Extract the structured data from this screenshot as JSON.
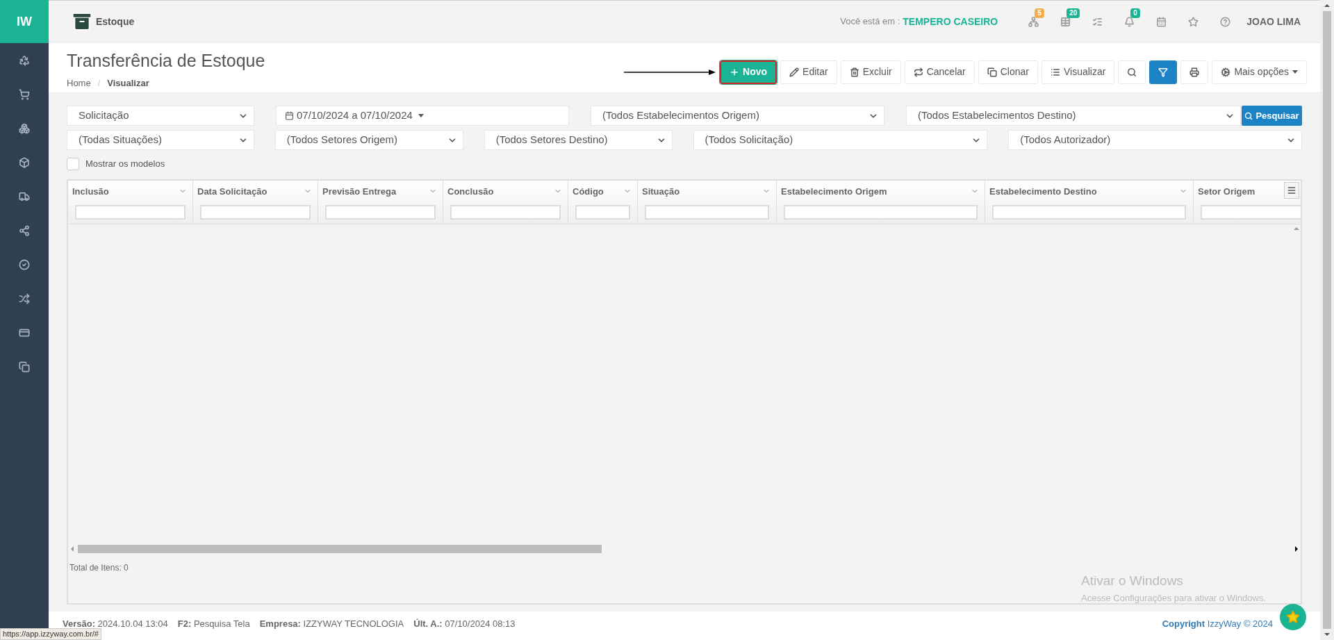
{
  "sidebar": {
    "logo": "IW"
  },
  "header": {
    "module": "Estoque",
    "location_label": "Você está em :",
    "location": "TEMPERO CASEIRO",
    "user": "JOAO LIMA",
    "icons": [
      {
        "kind": "sitemap",
        "badge": "5",
        "color": "#f0ad4e"
      },
      {
        "kind": "table",
        "badge": "20",
        "color": "#1ab394"
      },
      {
        "kind": "tasks"
      },
      {
        "kind": "bell",
        "badge": "0",
        "color": "#1ab394"
      },
      {
        "kind": "calendar"
      },
      {
        "kind": "star"
      },
      {
        "kind": "help"
      }
    ]
  },
  "page": {
    "title": "Transferência de Estoque",
    "breadcrumb": [
      "Home",
      "Visualizar"
    ],
    "breadcrumb_separator": "/"
  },
  "toolbar": [
    {
      "kind": "new",
      "label": "Novo"
    },
    {
      "kind": "edit",
      "label": "Editar"
    },
    {
      "kind": "delete",
      "label": "Excluir"
    },
    {
      "kind": "cancel",
      "label": "Cancelar"
    },
    {
      "kind": "clone",
      "label": "Clonar"
    },
    {
      "kind": "view",
      "label": "Visualizar"
    },
    {
      "kind": "search"
    },
    {
      "kind": "filter"
    },
    {
      "kind": "print"
    },
    {
      "kind": "more",
      "label": "Mais opções"
    }
  ],
  "filters": {
    "row_1": [
      {
        "kind": "select",
        "value": "Solicitação"
      },
      {
        "kind": "daterange",
        "value": "07/10/2024 a 07/10/2024"
      },
      {
        "kind": "select",
        "value": "(Todos Estabelecimentos Origem)"
      },
      {
        "kind": "select",
        "value": "(Todos Estabelecimentos Destino)"
      }
    ],
    "search_button": "Pesquisar",
    "row_2": [
      {
        "kind": "select",
        "value": "(Todas Situações)"
      },
      {
        "kind": "select",
        "value": "(Todos Setores Origem)"
      },
      {
        "kind": "select",
        "value": "(Todos Setores Destino)"
      },
      {
        "kind": "select",
        "value": "(Todos Solicitação)"
      },
      {
        "kind": "select",
        "value": "(Todos Autorizador)"
      }
    ],
    "checkbox": {
      "label": "Mostrar os modelos",
      "checked": false
    }
  },
  "table": {
    "columns": [
      "Inclusão",
      "Data Solicitação",
      "Previsão Entrega",
      "Conclusão",
      "Código",
      "Situação",
      "Estabelecimento Origem",
      "Estabelecimento Destino",
      "Setor Origem"
    ],
    "total": "Total de Itens: 0"
  },
  "windows_notice": {
    "title": "Ativar o Windows",
    "subtitle": "Acesse Configurações para ativar o Windows."
  },
  "footer": {
    "items": [
      {
        "label": "Versão:",
        "value": "2024.10.04 13:04"
      },
      {
        "label": "F2:",
        "value": "Pesquisa Tela"
      },
      {
        "label": "Empresa:",
        "value": "IZZYWAY TECNOLOGIA"
      },
      {
        "label": "Últ. A.:",
        "value": "07/10/2024 08:13"
      }
    ],
    "copyright_label": "Copyright",
    "copyright": "IzzyWay © 2024",
    "status_url": "https://app.izzyway.com.br/#"
  }
}
